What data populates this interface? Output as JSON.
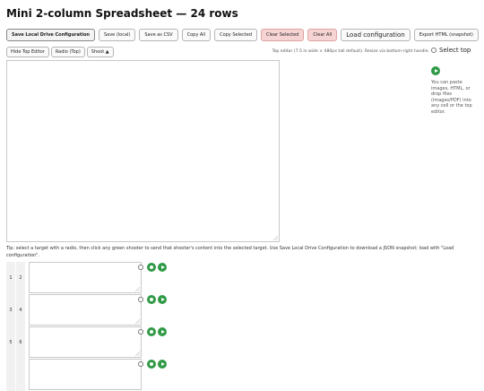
{
  "title": "Mini 2-column Spreadsheet — 24 rows",
  "toolbar": {
    "save_local_drive": "Save Local Drive Configuration",
    "save_local": "Save (local)",
    "save_csv": "Save as CSV",
    "copy_all": "Copy All",
    "copy_selected": "Copy Selected",
    "clear_selected": "Clear Selected",
    "clear_all": "Clear All",
    "load_configuration": "Load configuration",
    "export_html": "Export HTML (snapshot)"
  },
  "editor_toolbar": {
    "hide_top_editor": "Hide Top Editor",
    "radio_top": "Radio (Top)",
    "shoot": "Shoot ▲"
  },
  "editor_hint": "Top editor (7.5 in wide × 480px tall default). Resize via bottom-right handle.",
  "side": {
    "select_top_label": "Select top",
    "note": "You can paste images, HTML, or drop files (images/PDF) into any cell or the top editor."
  },
  "tip": "Tip: select a target with a radio, then click any green shooter to send that shooter's content into the selected target. Use Save Local Drive Configuration to download a JSON snapshot; load with \"Load configuration\".",
  "rows": [
    {
      "a": "1",
      "b": "2"
    },
    {
      "a": "3",
      "b": "4"
    },
    {
      "a": "5",
      "b": "6"
    },
    {
      "a": "",
      "b": ""
    }
  ],
  "colors": {
    "shooter_green": "#2f9a45",
    "danger_bg": "#f7d4d4"
  },
  "icons": {
    "shooter": "play-circle-icon",
    "target": "dot-circle-icon",
    "resize": "resize-grip-icon"
  }
}
